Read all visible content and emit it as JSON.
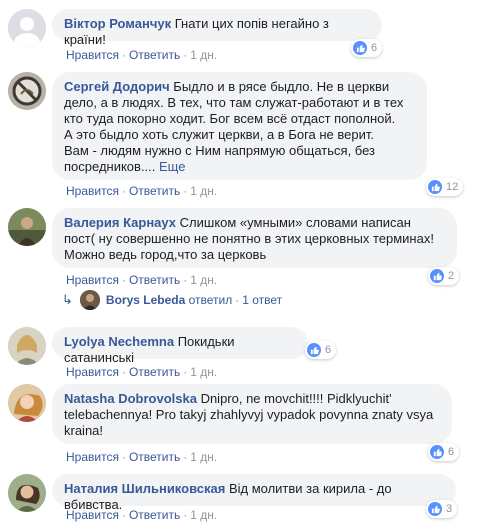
{
  "comments": [
    {
      "author": "Віктор Романчук",
      "text": "Гнати цих попів негайно з країни!",
      "more": "",
      "like_label": "Нравится",
      "reply_label": "Ответить",
      "time": "1 дн.",
      "reactions": "6"
    },
    {
      "author": "Сергей Додорич",
      "text": "Быдло и в рясе быдло. Не в церкви дело, а в людях. В тех, что там служат-работают и в тех кто туда покорно ходит. Бог всем всё отдаст пополной.\nА это быдло хоть служит церкви, а в Бога не верит.\nВам - людям нужно с Ним напрямую общаться, без посредников....",
      "more": "Еще",
      "like_label": "Нравится",
      "reply_label": "Ответить",
      "time": "1 дн.",
      "reactions": "12"
    },
    {
      "author": "Валерия Карнаух",
      "text": "Слишком «умными» словами написан пост( ну совершенно не понятно в этих церковных терминах! Можно ведь город,что за церковь",
      "more": "",
      "like_label": "Нравится",
      "reply_label": "Ответить",
      "time": "1 дн.",
      "reactions": "2"
    },
    {
      "author": "Lyolya Nechemna",
      "text": "Покидьки сатанинські",
      "more": "",
      "like_label": "Нравится",
      "reply_label": "Ответить",
      "time": "1 дн.",
      "reactions": "6"
    },
    {
      "author": "Natasha Dobrovolska",
      "text": "Dnipro, ne movchit!!!! Pidklyuchit' telebachennya! Pro takyj zhahlyvyj vypadok povynna znaty vsya kraina!",
      "more": "",
      "like_label": "Нравится",
      "reply_label": "Ответить",
      "time": "1 дн.",
      "reactions": "6"
    },
    {
      "author": "Наталия Шильниковская",
      "text": "Від молитви за кирила - до вбивства.",
      "more": "",
      "like_label": "Нравится",
      "reply_label": "Ответить",
      "time": "1 дн.",
      "reactions": "3"
    }
  ],
  "reply_thread": {
    "name": "Borys Lebeda",
    "action": "ответил",
    "count": "1 ответ"
  },
  "colors": {
    "link": "#385898",
    "meta": "#90949c",
    "bubble": "#f2f3f5",
    "like": "#5890ff"
  },
  "icons": [
    "like-icon",
    "reply-arrow-icon",
    "default-avatar-icon"
  ]
}
